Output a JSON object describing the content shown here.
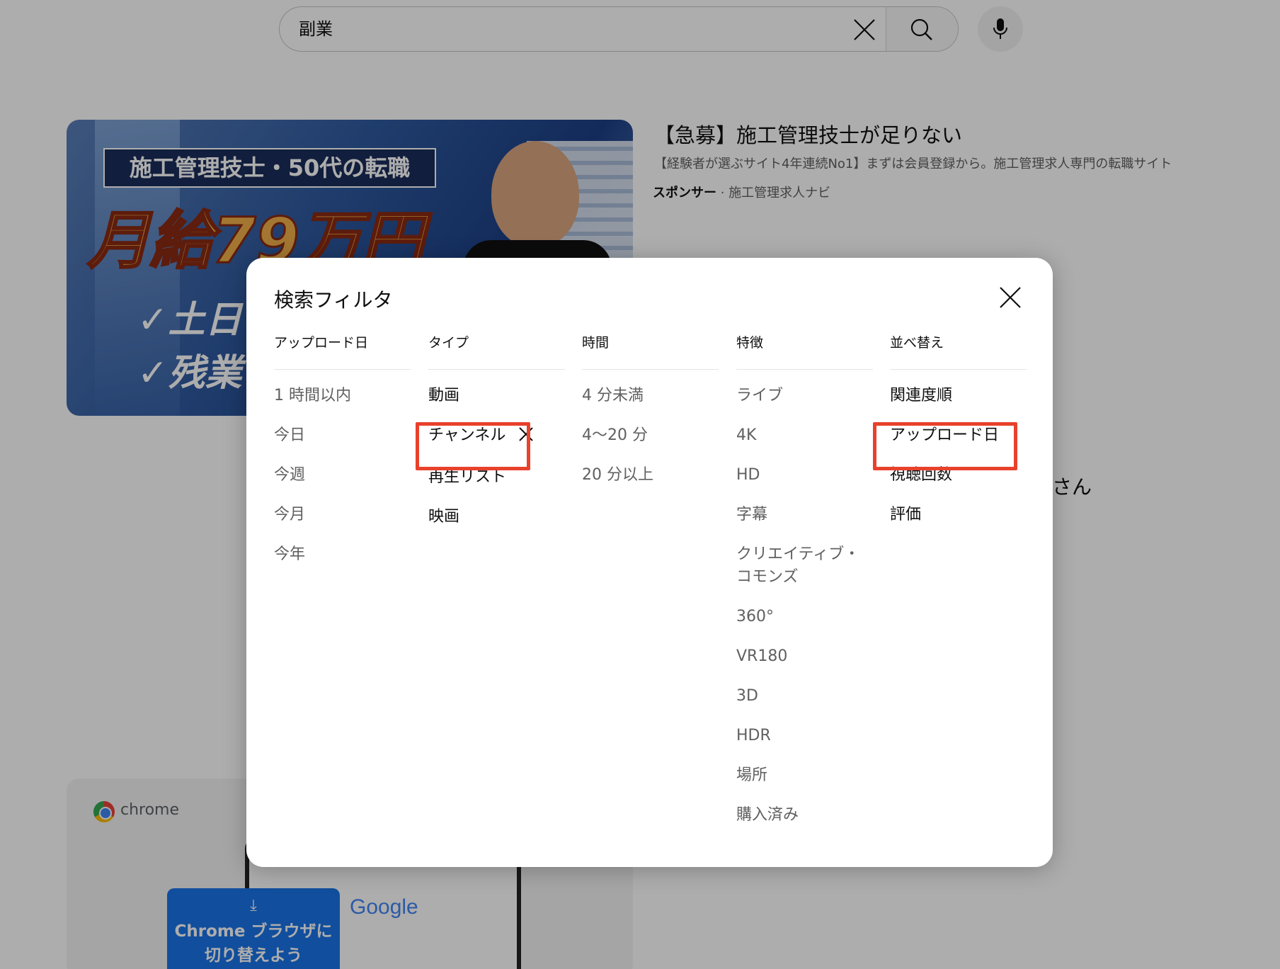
{
  "search": {
    "query": "副業"
  },
  "ad": {
    "thumbnail": {
      "banner": "施工管理技士・50代の転職",
      "salary": "月給79万円",
      "bullet1": "✓土日",
      "bullet2": "✓残業"
    },
    "title": "【急募】施工管理技士が足りない",
    "description": "【経験者が選ぶサイト4年連続No1】まずは会員登録から。施工管理求人専門の転職サイト",
    "sponsor_label": "スポンサー",
    "sponsor_separator": " · ",
    "sponsor_name": "施工管理求人ナビ"
  },
  "peek_text": "さん",
  "chrome_ad": {
    "brand": "chrome",
    "google": "Google",
    "cta_icon": "⤓",
    "cta_line1": "Chrome ブラウザに",
    "cta_line2": "切り替えよう"
  },
  "dialog": {
    "title": "検索フィルタ",
    "columns": [
      {
        "header": "アップロード日",
        "items": [
          "1 時間以内",
          "今日",
          "今週",
          "今月",
          "今年"
        ]
      },
      {
        "header": "タイプ",
        "items": [
          "動画",
          "チャンネル",
          "再生リスト",
          "映画"
        ]
      },
      {
        "header": "時間",
        "items": [
          "4 分未満",
          "4〜20 分",
          "20 分以上"
        ]
      },
      {
        "header": "特徴",
        "items": [
          "ライブ",
          "4K",
          "HD",
          "字幕",
          "クリエイティブ・コモンズ",
          "360°",
          "VR180",
          "3D",
          "HDR",
          "場所",
          "購入済み"
        ]
      },
      {
        "header": "並べ替え",
        "items": [
          "関連度順",
          "アップロード日",
          "視聴回数",
          "評価"
        ]
      }
    ],
    "active_filters": [
      "チャンネル"
    ],
    "active_sort": "アップロード日"
  },
  "colors": {
    "highlight": "#e8412c",
    "dialog_bg": "#ffffff",
    "text_primary": "#0f0f0f",
    "text_secondary": "#606060"
  },
  "icons": [
    "close-icon",
    "search-icon",
    "mic-icon",
    "remove-filter-icon"
  ]
}
